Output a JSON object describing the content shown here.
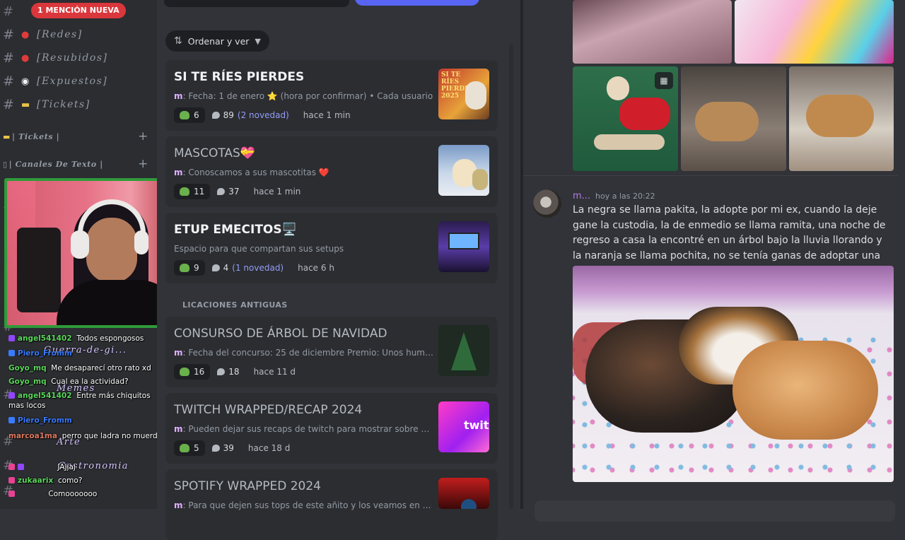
{
  "sidebar": {
    "mention_pill": "1 MENCIÓN NUEVA",
    "channels": [
      {
        "name": "[Redes]",
        "icon": "cherry-icon"
      },
      {
        "name": "[Resubidos]",
        "icon": "cherry-icon"
      },
      {
        "name": "[Expuestos]",
        "icon": "clown-icon"
      },
      {
        "name": "[Tickets]",
        "icon": "ticket-icon"
      }
    ],
    "categories": [
      {
        "name": "| Tickets |",
        "plus": "+"
      },
      {
        "name": "| Canales De Texto |",
        "plus": "+"
      }
    ]
  },
  "stream_chat": {
    "lines": [
      {
        "user": "angel541402",
        "text": "Todos espongosos",
        "color": "#5bd65b"
      },
      {
        "user": "Piero_Fromm",
        "text": "",
        "color": "#3a7bff"
      },
      {
        "user": "Goyo_mq",
        "text": "Me desaparecí otro rato xd",
        "color": "#5bd65b"
      },
      {
        "user": "Goyo_mq",
        "text": "Cual ea la actividad?",
        "color": "#5bd65b"
      },
      {
        "user": "angel541402",
        "text": "Entre más chiquitos",
        "color": "#5bd65b"
      },
      {
        "user": "",
        "text": "mas locos",
        "color": "#ffffff"
      },
      {
        "user": "Piero_Fromm",
        "text": "",
        "color": "#3a7bff"
      },
      {
        "user": "marcoa1ma",
        "text": "perro que ladra no muerde",
        "color": "#e07a5f"
      },
      {
        "user": "",
        "text": "",
        "color": "#ffffff"
      },
      {
        "user": "",
        "text": "JAJjaj",
        "color": "#ffffff"
      },
      {
        "user": "zukaarix",
        "text": "como?",
        "color": "#5bd65b"
      },
      {
        "user": "",
        "text": "Comooooooo",
        "color": "#ffffff"
      }
    ],
    "overlay_channels": [
      "Guerra-de-gi...",
      "Memes",
      "Arte",
      "Gastronomia"
    ]
  },
  "forum": {
    "sort_label": "Ordenar y ver",
    "section_label": "LICACIONES ANTIGUAS",
    "posts": [
      {
        "title": "SI TE RÍES PIERDES",
        "author": "m",
        "snippet": "Fecha: 1 de enero ⭐ (hora por confirmar) • Cada usuario",
        "reactions": "6",
        "replies": "89",
        "new": "(2 novedad)",
        "ago": "hace 1 min",
        "dim": false
      },
      {
        "title": "MASCOTAS💝",
        "author": "m",
        "snippet": "Conoscamos a sus mascotitas ❤️",
        "reactions": "11",
        "replies": "37",
        "new": "",
        "ago": "hace 1 min",
        "dim": true
      },
      {
        "title": "ETUP EMECITOS🖥️",
        "author": "",
        "snippet": "Espacio para que compartan sus setups",
        "reactions": "9",
        "replies": "4",
        "new": "(1 novedad)",
        "ago": "hace 6 h",
        "dim": false
      },
      {
        "title": "CONSURSO DE ÁRBOL DE NAVIDAD",
        "author": "m",
        "snippet": "Fecha del concurso: 25 de diciembre Premio: Unos humil...",
        "reactions": "16",
        "replies": "18",
        "new": "",
        "ago": "hace 11 d",
        "dim": true
      },
      {
        "title": "TWITCH WRAPPED/RECAP 2024",
        "author": "m",
        "snippet": "Pueden dejar sus recaps de twitch para mostrar sobre el...",
        "reactions": "5",
        "replies": "39",
        "new": "",
        "ago": "hace 18 d",
        "dim": true
      },
      {
        "title": "SPOTIFY WRAPPED 2024",
        "author": "m",
        "snippet": "Para que dejen sus tops de este añito y los veamos en str...",
        "reactions": "",
        "replies": "",
        "new": "",
        "ago": "",
        "dim": true
      }
    ],
    "thumb1_text": "SI TE RÍES PIERDES 2025",
    "thumb5_text": "twit"
  },
  "thread": {
    "message": {
      "author": "m...",
      "time": "hoy a las 20:22",
      "text": "La negra se llama pakita, la adopte por mi ex, cuando la deje gane la custodia, la de enmedio se llama ramita, una noche de regreso a casa la encontré en un árbol bajo la lluvia llorando y la naranja se llama pochita, no se tenía ganas de adoptar una gata naranja"
    }
  },
  "colors": {
    "accent": "#5865f2",
    "mention": "#da373c",
    "webcam_border": "#2f9a3a"
  }
}
